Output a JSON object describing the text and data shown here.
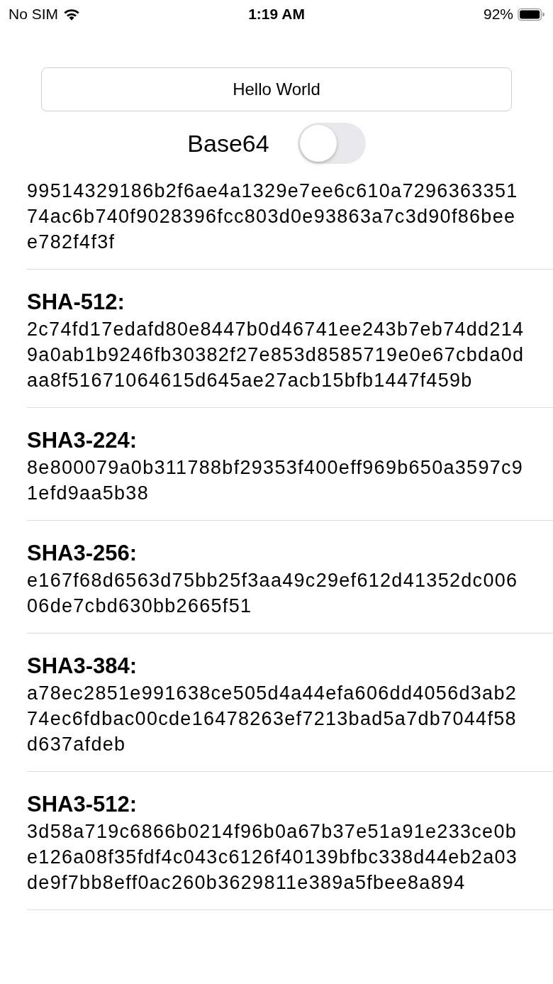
{
  "status_bar": {
    "carrier": "No SIM",
    "time": "1:19 AM",
    "battery": "92%"
  },
  "input": {
    "value": "Hello World"
  },
  "base64": {
    "label": "Base64",
    "on": false
  },
  "hashes": [
    {
      "value": "99514329186b2f6ae4a1329e7ee6c610a729636335174ac6b740f9028396fcc803d0e93863a7c3d90f86beee782f4f3f"
    },
    {
      "name": "SHA-512:",
      "value": "2c74fd17edafd80e8447b0d46741ee243b7eb74dd2149a0ab1b9246fb30382f27e853d8585719e0e67cbda0daa8f51671064615d645ae27acb15bfb1447f459b"
    },
    {
      "name": "SHA3-224:",
      "value": "8e800079a0b311788bf29353f400eff969b650a3597c91efd9aa5b38"
    },
    {
      "name": "SHA3-256:",
      "value": "e167f68d6563d75bb25f3aa49c29ef612d41352dc00606de7cbd630bb2665f51"
    },
    {
      "name": "SHA3-384:",
      "value": "a78ec2851e991638ce505d4a44efa606dd4056d3ab274ec6fdbac00cde16478263ef7213bad5a7db7044f58d637afdeb"
    },
    {
      "name": "SHA3-512:",
      "value": "3d58a719c6866b0214f96b0a67b37e51a91e233ce0be126a08f35fdf4c043c6126f40139bfbc338d44eb2a03de9f7bb8eff0ac260b3629811e389a5fbee8a894"
    }
  ]
}
